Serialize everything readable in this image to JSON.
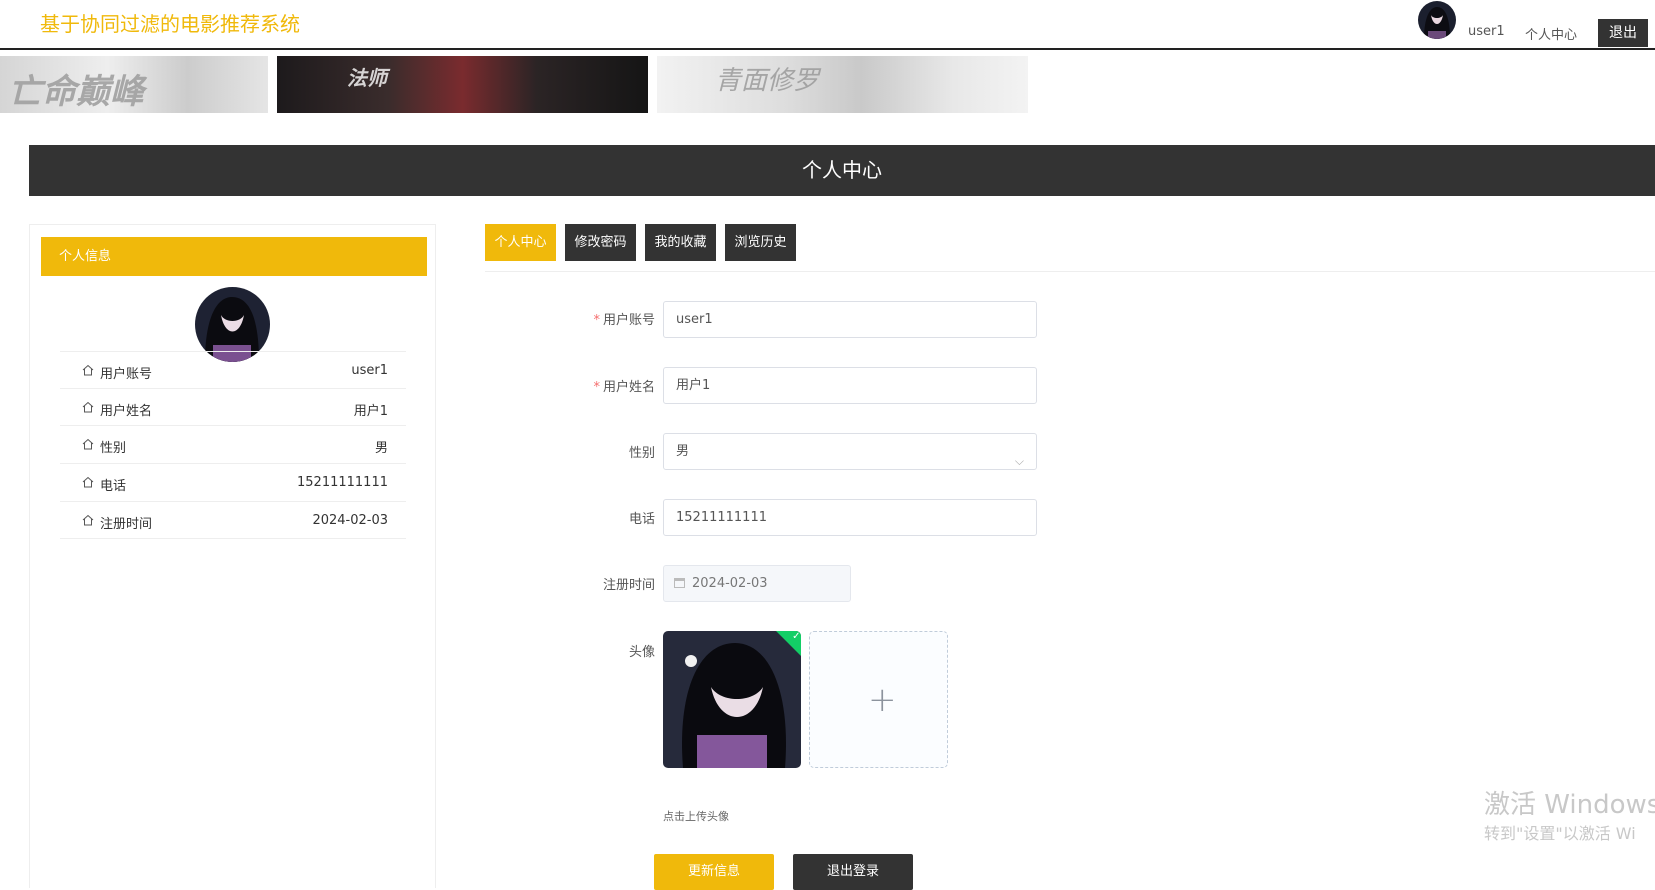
{
  "header": {
    "site_title": "基于协同过滤的电影推荐系统",
    "username": "user1",
    "personal_center_link": "个人中心",
    "logout_button": "退出"
  },
  "banners": [
    {
      "text": "亡命巅峰"
    },
    {
      "text": "法师"
    },
    {
      "text": "青面修罗"
    }
  ],
  "page": {
    "section_title": "个人中心"
  },
  "profile_card": {
    "title": "个人信息",
    "rows": [
      {
        "label": "用户账号",
        "value": "user1"
      },
      {
        "label": "用户姓名",
        "value": "用户1"
      },
      {
        "label": "性别",
        "value": "男"
      },
      {
        "label": "电话",
        "value": "15211111111"
      },
      {
        "label": "注册时间",
        "value": "2024-02-03"
      }
    ]
  },
  "tabs": [
    {
      "label": "个人中心",
      "active": true
    },
    {
      "label": "修改密码",
      "active": false
    },
    {
      "label": "我的收藏",
      "active": false
    },
    {
      "label": "浏览历史",
      "active": false
    }
  ],
  "form": {
    "account": {
      "label": "用户账号",
      "value": "user1",
      "required": "*"
    },
    "name": {
      "label": "用户姓名",
      "value": "用户1",
      "required": "*"
    },
    "gender": {
      "label": "性别",
      "value": "男"
    },
    "phone": {
      "label": "电话",
      "value": "15211111111"
    },
    "register_time": {
      "label": "注册时间",
      "value": "2024-02-03"
    },
    "avatar": {
      "label": "头像",
      "hint": "点击上传头像",
      "upload_symbol": "+"
    },
    "update_button": "更新信息",
    "logout_button": "退出登录"
  },
  "windows_watermark": {
    "line1": "激活 Windows",
    "line2": "转到\"设置\"以激活 Wi"
  },
  "colors": {
    "accent": "#f0b90b",
    "dark": "#333333",
    "success": "#13ce66"
  }
}
